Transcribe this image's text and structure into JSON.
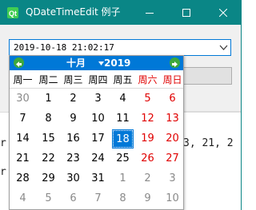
{
  "window": {
    "title": "QDateTimeEdit 例子",
    "icons": {
      "app": "qt-icon",
      "minimize": "minimize-icon",
      "maximize": "maximize-icon",
      "close": "close-icon"
    },
    "accent_color": "#0a8686"
  },
  "datetime_edit": {
    "value": "2019-10-18 21:02:17",
    "dropdown_icon": "chevron-down-icon"
  },
  "background_text": {
    "left_fragments": [
      "r",
      "r"
    ],
    "right_fragment": "3, 21, 2"
  },
  "calendar": {
    "month_label": "十月",
    "year_label": "2019",
    "prev_icon": "arrow-left-icon",
    "next_icon": "arrow-right-icon",
    "header_color": "#0078d7",
    "weekend_color": "#e00000",
    "weekdays": [
      {
        "label": "周一",
        "weekend": false
      },
      {
        "label": "周二",
        "weekend": false
      },
      {
        "label": "周三",
        "weekend": false
      },
      {
        "label": "周四",
        "weekend": false
      },
      {
        "label": "周五",
        "weekend": false
      },
      {
        "label": "周六",
        "weekend": true
      },
      {
        "label": "周日",
        "weekend": true
      }
    ],
    "weeks": [
      [
        {
          "d": "30",
          "other": true
        },
        {
          "d": "1"
        },
        {
          "d": "2"
        },
        {
          "d": "3"
        },
        {
          "d": "4"
        },
        {
          "d": "5",
          "weekend": true
        },
        {
          "d": "6",
          "weekend": true
        }
      ],
      [
        {
          "d": "7"
        },
        {
          "d": "8"
        },
        {
          "d": "9"
        },
        {
          "d": "10"
        },
        {
          "d": "11"
        },
        {
          "d": "12",
          "weekend": true
        },
        {
          "d": "13",
          "weekend": true
        }
      ],
      [
        {
          "d": "14"
        },
        {
          "d": "15"
        },
        {
          "d": "16"
        },
        {
          "d": "17"
        },
        {
          "d": "18",
          "selected": true
        },
        {
          "d": "19",
          "weekend": true
        },
        {
          "d": "20",
          "weekend": true
        }
      ],
      [
        {
          "d": "21"
        },
        {
          "d": "22"
        },
        {
          "d": "23"
        },
        {
          "d": "24"
        },
        {
          "d": "25"
        },
        {
          "d": "26",
          "weekend": true
        },
        {
          "d": "27",
          "weekend": true
        }
      ],
      [
        {
          "d": "28"
        },
        {
          "d": "29"
        },
        {
          "d": "30"
        },
        {
          "d": "31"
        },
        {
          "d": "1",
          "other": true
        },
        {
          "d": "2",
          "other": true
        },
        {
          "d": "3",
          "other": true
        }
      ],
      [
        {
          "d": "4",
          "other": true
        },
        {
          "d": "5",
          "other": true
        },
        {
          "d": "6",
          "other": true
        },
        {
          "d": "7",
          "other": true
        },
        {
          "d": "8",
          "other": true
        },
        {
          "d": "9",
          "other": true
        },
        {
          "d": "10",
          "other": true
        }
      ]
    ]
  }
}
